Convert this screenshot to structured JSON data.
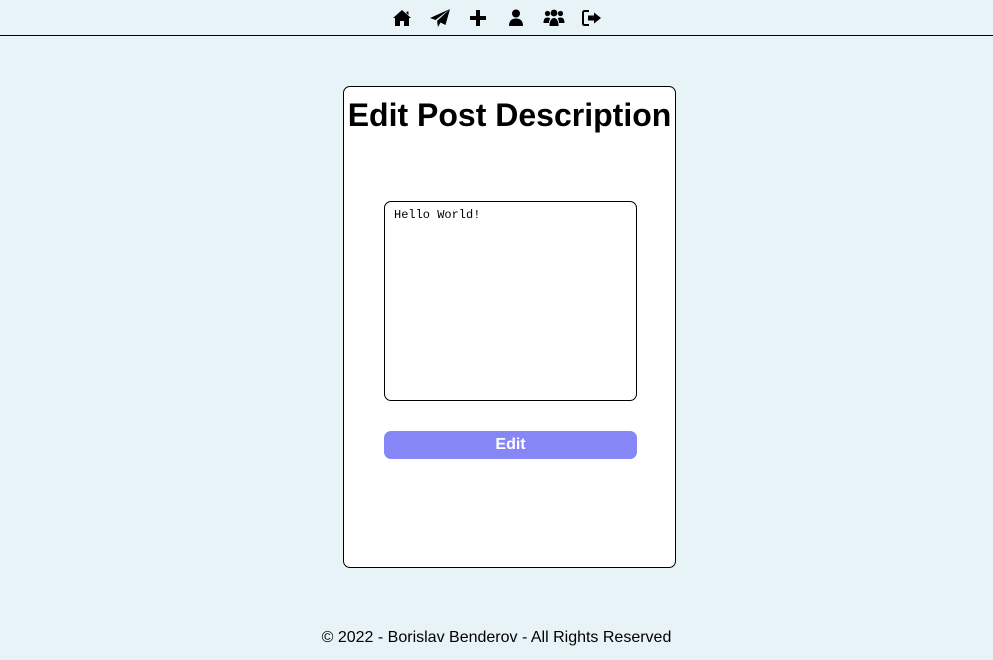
{
  "nav": {
    "items": [
      {
        "icon": "home-icon"
      },
      {
        "icon": "paper-plane-icon"
      },
      {
        "icon": "plus-icon"
      },
      {
        "icon": "user-icon"
      },
      {
        "icon": "users-icon"
      },
      {
        "icon": "sign-out-icon"
      }
    ]
  },
  "form": {
    "title": "Edit Post Description",
    "description_value": "Hello World!",
    "submit_label": "Edit"
  },
  "footer": {
    "text": "© 2022 - Borislav Benderov - All Rights Reserved"
  },
  "colors": {
    "page_background": "#e8f3f8",
    "card_background": "#ffffff",
    "button_background": "#8686f6",
    "button_text": "#ffffff"
  }
}
